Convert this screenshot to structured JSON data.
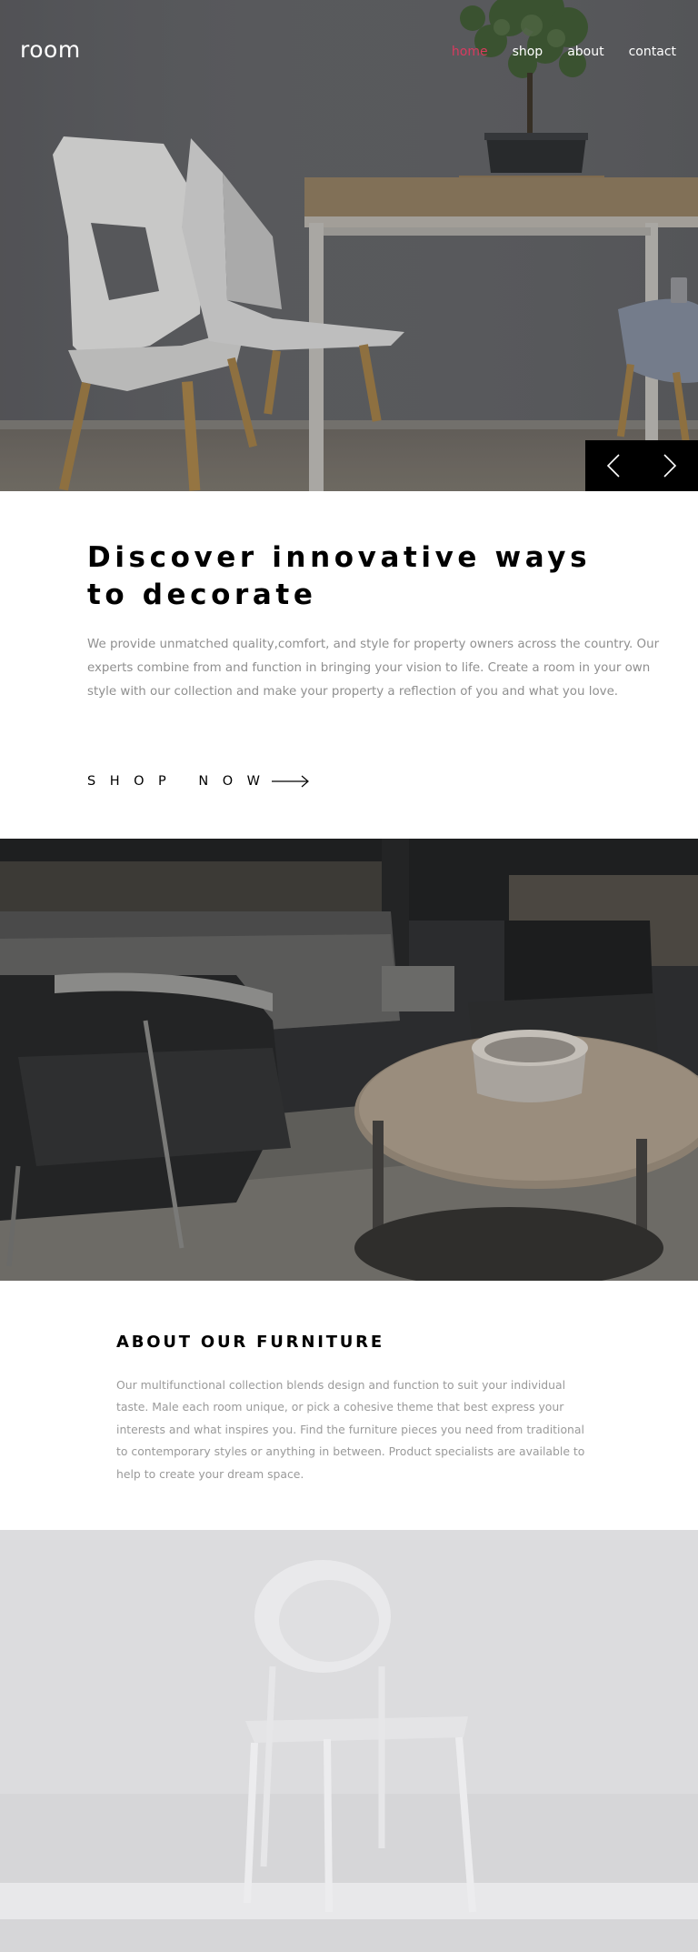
{
  "nav": {
    "logo": "room",
    "links": [
      {
        "label": "home",
        "active": true
      },
      {
        "label": "shop",
        "active": false
      },
      {
        "label": "about",
        "active": false
      },
      {
        "label": "contact",
        "active": false
      }
    ],
    "active_color": "#d93a5f"
  },
  "hero": {
    "image": "dining table with white chairs and bonsai plant",
    "prev_icon": "chevron-left-icon",
    "next_icon": "chevron-right-icon"
  },
  "discover": {
    "title": "Discover innovative ways to decorate",
    "text": "We provide unmatched quality,comfort, and style for property owners across the country. Our experts combine from and function in bringing your vision to life. Create a room in your own style with our collection and make your property a reflection of you and what you love.",
    "cta_label": "SHOP NOW",
    "cta_icon": "arrow-right-icon"
  },
  "images": {
    "dark": "dark armchairs with round coffee table",
    "light": "white chair against light wall"
  },
  "about": {
    "title": "ABOUT OUR FURNITURE",
    "text": "Our multifunctional collection blends design and function to suit your individual taste. Male each room unique, or pick a cohesive theme that best express your interests and what inspires you. Find the furniture pieces you need from traditional to contemporary styles or anything in between. Product specialists are available to help to create your dream space."
  }
}
